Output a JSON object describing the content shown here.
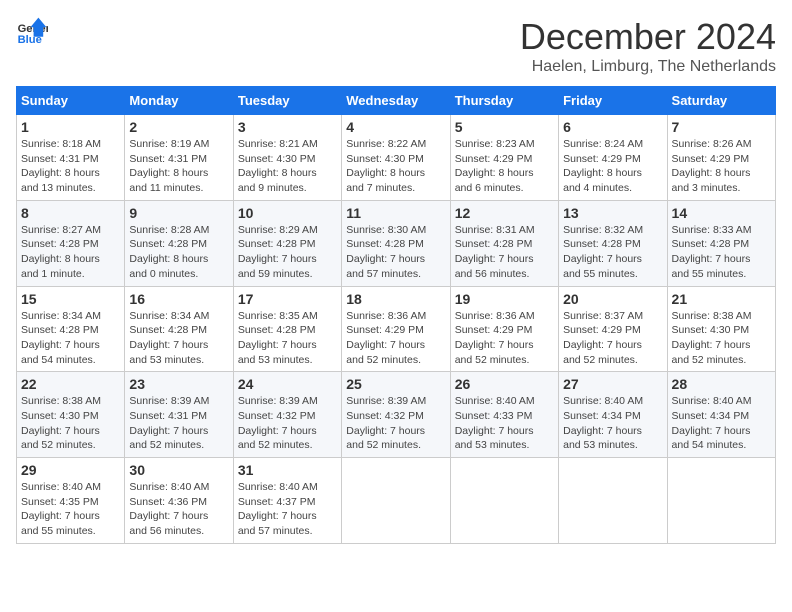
{
  "logo": {
    "line1": "General",
    "line2": "Blue"
  },
  "title": "December 2024",
  "location": "Haelen, Limburg, The Netherlands",
  "weekdays": [
    "Sunday",
    "Monday",
    "Tuesday",
    "Wednesday",
    "Thursday",
    "Friday",
    "Saturday"
  ],
  "weeks": [
    [
      {
        "day": "1",
        "info": "Sunrise: 8:18 AM\nSunset: 4:31 PM\nDaylight: 8 hours\nand 13 minutes."
      },
      {
        "day": "2",
        "info": "Sunrise: 8:19 AM\nSunset: 4:31 PM\nDaylight: 8 hours\nand 11 minutes."
      },
      {
        "day": "3",
        "info": "Sunrise: 8:21 AM\nSunset: 4:30 PM\nDaylight: 8 hours\nand 9 minutes."
      },
      {
        "day": "4",
        "info": "Sunrise: 8:22 AM\nSunset: 4:30 PM\nDaylight: 8 hours\nand 7 minutes."
      },
      {
        "day": "5",
        "info": "Sunrise: 8:23 AM\nSunset: 4:29 PM\nDaylight: 8 hours\nand 6 minutes."
      },
      {
        "day": "6",
        "info": "Sunrise: 8:24 AM\nSunset: 4:29 PM\nDaylight: 8 hours\nand 4 minutes."
      },
      {
        "day": "7",
        "info": "Sunrise: 8:26 AM\nSunset: 4:29 PM\nDaylight: 8 hours\nand 3 minutes."
      }
    ],
    [
      {
        "day": "8",
        "info": "Sunrise: 8:27 AM\nSunset: 4:28 PM\nDaylight: 8 hours\nand 1 minute."
      },
      {
        "day": "9",
        "info": "Sunrise: 8:28 AM\nSunset: 4:28 PM\nDaylight: 8 hours\nand 0 minutes."
      },
      {
        "day": "10",
        "info": "Sunrise: 8:29 AM\nSunset: 4:28 PM\nDaylight: 7 hours\nand 59 minutes."
      },
      {
        "day": "11",
        "info": "Sunrise: 8:30 AM\nSunset: 4:28 PM\nDaylight: 7 hours\nand 57 minutes."
      },
      {
        "day": "12",
        "info": "Sunrise: 8:31 AM\nSunset: 4:28 PM\nDaylight: 7 hours\nand 56 minutes."
      },
      {
        "day": "13",
        "info": "Sunrise: 8:32 AM\nSunset: 4:28 PM\nDaylight: 7 hours\nand 55 minutes."
      },
      {
        "day": "14",
        "info": "Sunrise: 8:33 AM\nSunset: 4:28 PM\nDaylight: 7 hours\nand 55 minutes."
      }
    ],
    [
      {
        "day": "15",
        "info": "Sunrise: 8:34 AM\nSunset: 4:28 PM\nDaylight: 7 hours\nand 54 minutes."
      },
      {
        "day": "16",
        "info": "Sunrise: 8:34 AM\nSunset: 4:28 PM\nDaylight: 7 hours\nand 53 minutes."
      },
      {
        "day": "17",
        "info": "Sunrise: 8:35 AM\nSunset: 4:28 PM\nDaylight: 7 hours\nand 53 minutes."
      },
      {
        "day": "18",
        "info": "Sunrise: 8:36 AM\nSunset: 4:29 PM\nDaylight: 7 hours\nand 52 minutes."
      },
      {
        "day": "19",
        "info": "Sunrise: 8:36 AM\nSunset: 4:29 PM\nDaylight: 7 hours\nand 52 minutes."
      },
      {
        "day": "20",
        "info": "Sunrise: 8:37 AM\nSunset: 4:29 PM\nDaylight: 7 hours\nand 52 minutes."
      },
      {
        "day": "21",
        "info": "Sunrise: 8:38 AM\nSunset: 4:30 PM\nDaylight: 7 hours\nand 52 minutes."
      }
    ],
    [
      {
        "day": "22",
        "info": "Sunrise: 8:38 AM\nSunset: 4:30 PM\nDaylight: 7 hours\nand 52 minutes."
      },
      {
        "day": "23",
        "info": "Sunrise: 8:39 AM\nSunset: 4:31 PM\nDaylight: 7 hours\nand 52 minutes."
      },
      {
        "day": "24",
        "info": "Sunrise: 8:39 AM\nSunset: 4:32 PM\nDaylight: 7 hours\nand 52 minutes."
      },
      {
        "day": "25",
        "info": "Sunrise: 8:39 AM\nSunset: 4:32 PM\nDaylight: 7 hours\nand 52 minutes."
      },
      {
        "day": "26",
        "info": "Sunrise: 8:40 AM\nSunset: 4:33 PM\nDaylight: 7 hours\nand 53 minutes."
      },
      {
        "day": "27",
        "info": "Sunrise: 8:40 AM\nSunset: 4:34 PM\nDaylight: 7 hours\nand 53 minutes."
      },
      {
        "day": "28",
        "info": "Sunrise: 8:40 AM\nSunset: 4:34 PM\nDaylight: 7 hours\nand 54 minutes."
      }
    ],
    [
      {
        "day": "29",
        "info": "Sunrise: 8:40 AM\nSunset: 4:35 PM\nDaylight: 7 hours\nand 55 minutes."
      },
      {
        "day": "30",
        "info": "Sunrise: 8:40 AM\nSunset: 4:36 PM\nDaylight: 7 hours\nand 56 minutes."
      },
      {
        "day": "31",
        "info": "Sunrise: 8:40 AM\nSunset: 4:37 PM\nDaylight: 7 hours\nand 57 minutes."
      },
      null,
      null,
      null,
      null
    ]
  ]
}
